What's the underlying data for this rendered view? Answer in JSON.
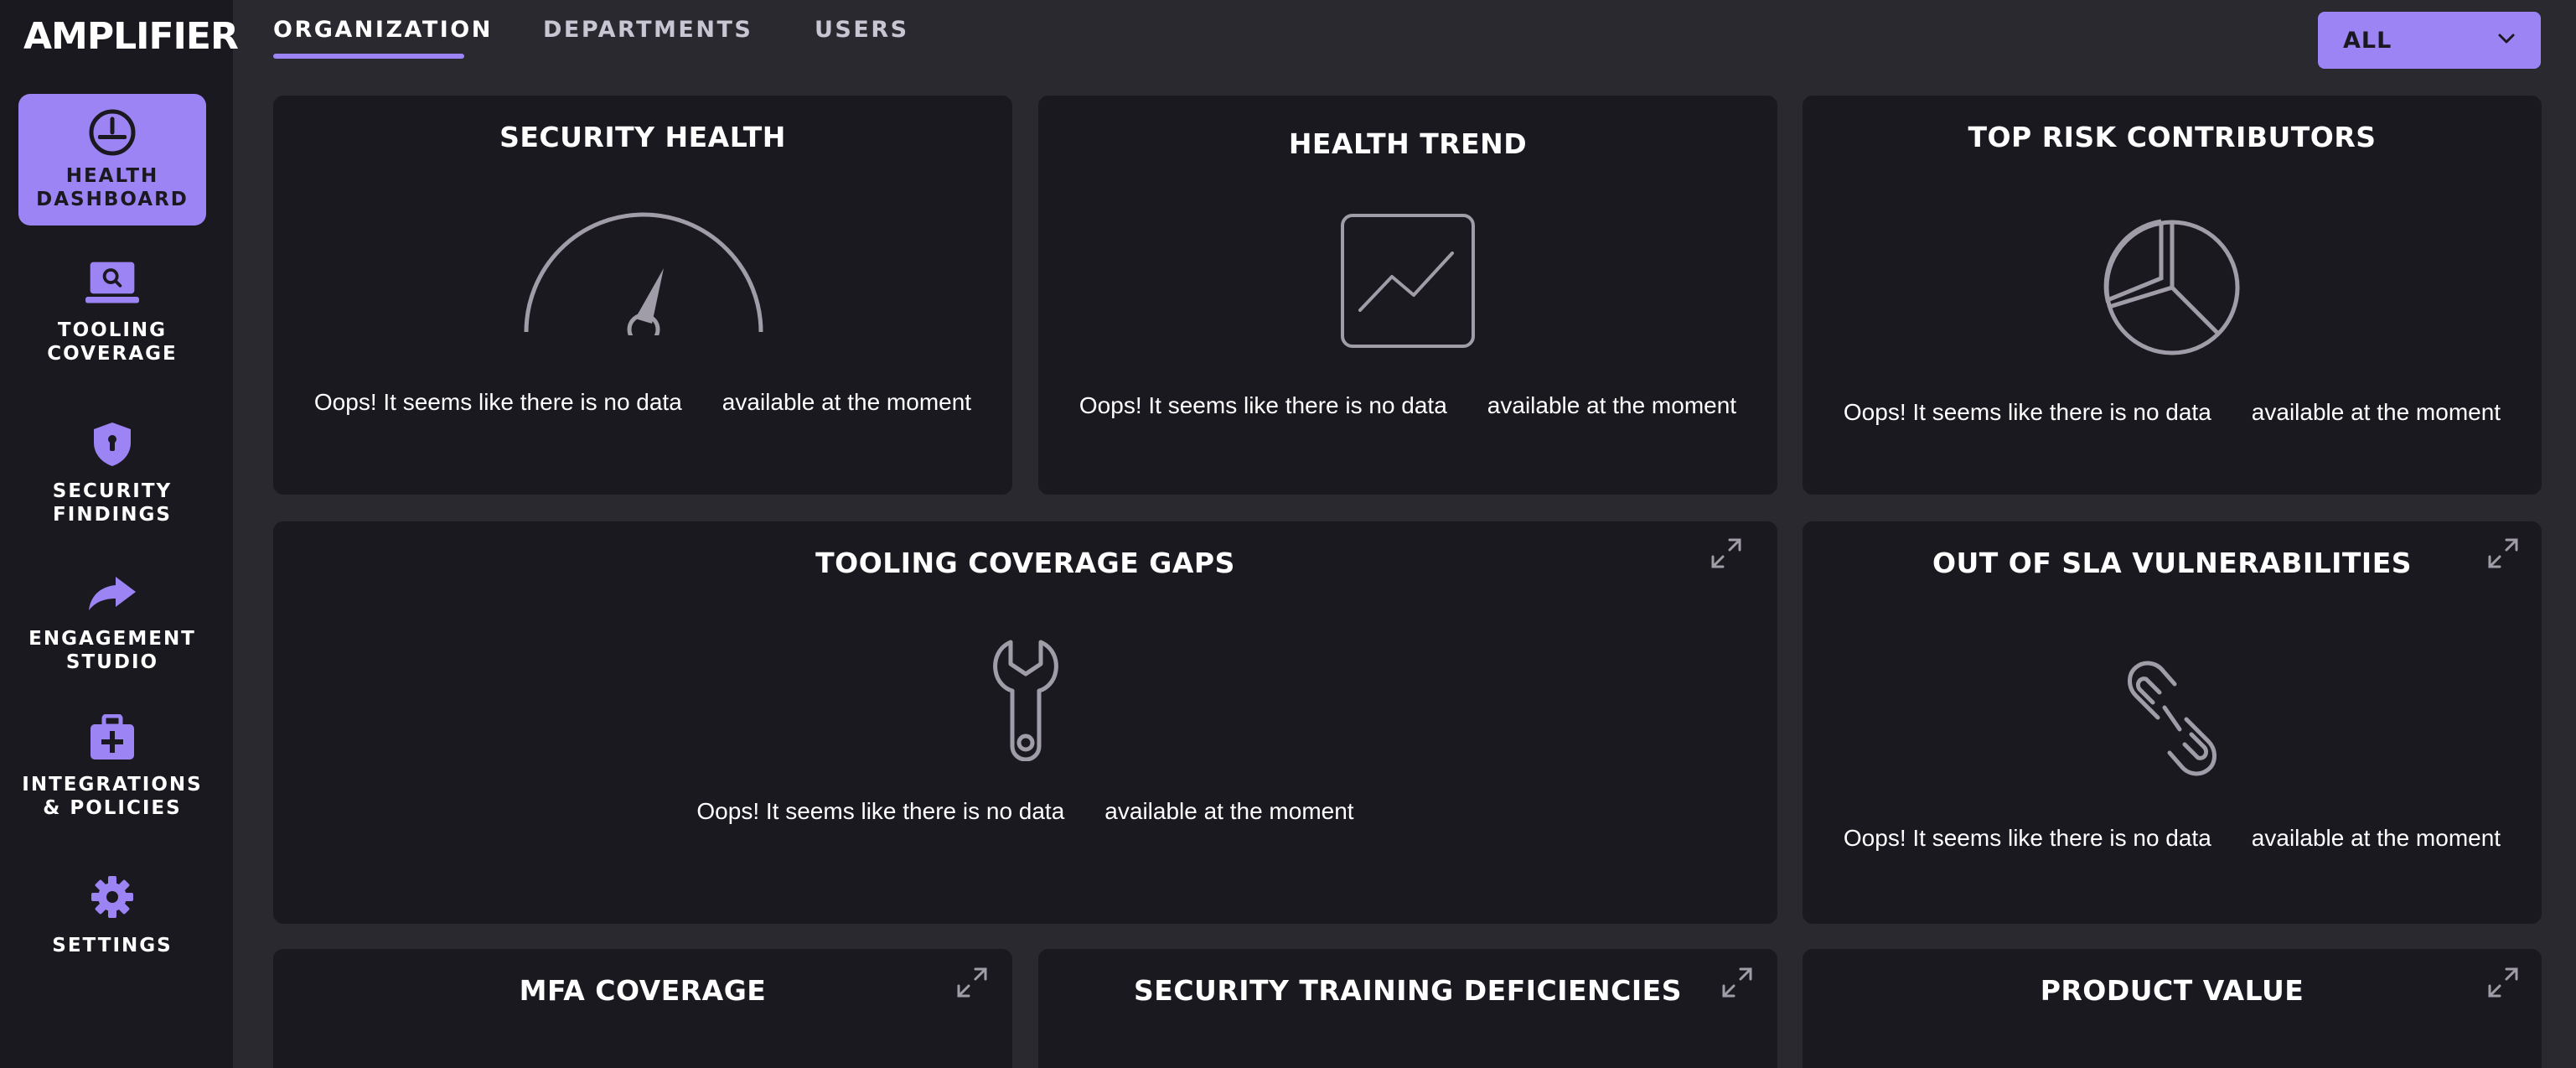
{
  "app": {
    "logo": "AMPLIFIER"
  },
  "sidebar": {
    "items": [
      {
        "label": "HEALTH\nDASHBOARD",
        "icon": "gauge-icon",
        "active": true
      },
      {
        "label": "TOOLING\nCOVERAGE",
        "icon": "laptop-search-icon",
        "active": false
      },
      {
        "label": "SECURITY\nFINDINGS",
        "icon": "shield-icon",
        "active": false
      },
      {
        "label": "ENGAGEMENT\nSTUDIO",
        "icon": "share-arrow-icon",
        "active": false
      },
      {
        "label": "INTEGRATIONS\n& POLICIES",
        "icon": "medical-kit-icon",
        "active": false
      },
      {
        "label": "SETTINGS",
        "icon": "gear-icon",
        "active": false
      }
    ]
  },
  "tabs": [
    {
      "label": "ORGANIZATION",
      "active": true
    },
    {
      "label": "DEPARTMENTS",
      "active": false
    },
    {
      "label": "USERS",
      "active": false
    }
  ],
  "filter": {
    "value": "ALL"
  },
  "empty_message": {
    "part1": "Oops! It seems like there is no data",
    "part2": "available at the moment"
  },
  "cards": [
    {
      "title": "SECURITY HEALTH",
      "icon": "gauge-icon"
    },
    {
      "title": "HEALTH TREND",
      "icon": "trend-chart-icon"
    },
    {
      "title": "TOP RISK CONTRIBUTORS",
      "icon": "pie-chart-icon"
    },
    {
      "title": "TOOLING COVERAGE GAPS",
      "icon": "wrench-icon"
    },
    {
      "title": "OUT OF SLA VULNERABILITIES",
      "icon": "broken-link-icon"
    },
    {
      "title": "MFA COVERAGE"
    },
    {
      "title": "SECURITY TRAINING DEFICIENCIES"
    },
    {
      "title": "PRODUCT VALUE"
    }
  ],
  "colors": {
    "accent": "#9d84f5",
    "background": "#2b2930",
    "panel": "#1b1920",
    "icon_gray": "#a09da8"
  }
}
